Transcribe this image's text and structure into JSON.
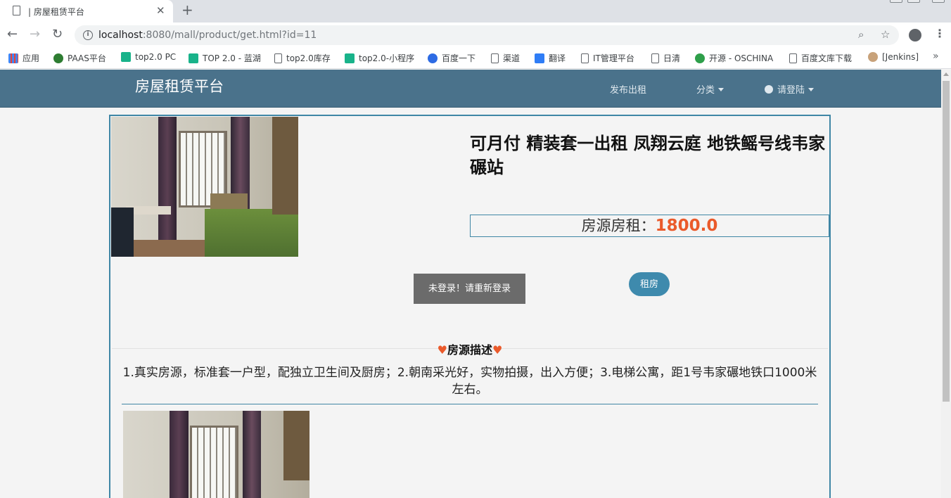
{
  "browser": {
    "tab_title": "| 房屋租赁平台",
    "url_host": "localhost",
    "url_rest": ":8080/mall/product/get.html?id=11",
    "bookmarks": [
      {
        "label": "应用",
        "icon": "apps-grid-icon",
        "color": "#ea4335"
      },
      {
        "label": "PAAS平台",
        "icon": "paas-logo-icon",
        "color": "#2e7d32"
      },
      {
        "label": "top2.0 PC",
        "icon": "play-icon",
        "color": "#19b38a"
      },
      {
        "label": "TOP 2.0 - 蓝湖",
        "icon": "play-icon",
        "color": "#19b38a"
      },
      {
        "label": "top2.0库存",
        "icon": "page-icon",
        "color": "#ffffff"
      },
      {
        "label": "top2.0-小程序",
        "icon": "play-icon",
        "color": "#19b38a"
      },
      {
        "label": "百度一下",
        "icon": "baidu-paw-icon",
        "color": "#2d6be4"
      },
      {
        "label": "渠道",
        "icon": "page-icon",
        "color": "#ffffff"
      },
      {
        "label": "翻译",
        "icon": "translate-icon",
        "color": "#2f7df6"
      },
      {
        "label": "IT管理平台",
        "icon": "page-icon",
        "color": "#ffffff"
      },
      {
        "label": "日清",
        "icon": "page-icon",
        "color": "#ffffff"
      },
      {
        "label": "开源 - OSCHINA",
        "icon": "oschina-icon",
        "color": "#2e9f4a"
      },
      {
        "label": "百度文库下载",
        "icon": "page-icon",
        "color": "#ffffff"
      },
      {
        "label": "[Jenkins]",
        "icon": "jenkins-icon",
        "color": "#c8a27a"
      }
    ]
  },
  "navbar": {
    "brand": "房屋租赁平台",
    "publish": "发布出租",
    "category": "分类",
    "login": "请登陆",
    "bg_color": "#4a728b"
  },
  "product": {
    "title": "可月付 精装套一出租 凤翔云庭 地铁鳐号线韦家碾站",
    "price_label": "房源房租：",
    "price_value": "1800.0",
    "price_color": "#ea5a2b",
    "rent_button": "租房",
    "toast": "未登录！请重新登录",
    "desc_heading": "房源描述",
    "desc_text": "1.真实房源，标准套一户型，配独立卫生间及厨房；2.朝南采光好，实物拍摄，出入方便；3.电梯公寓，距1号韦家碾地铁口1000米左右。"
  }
}
